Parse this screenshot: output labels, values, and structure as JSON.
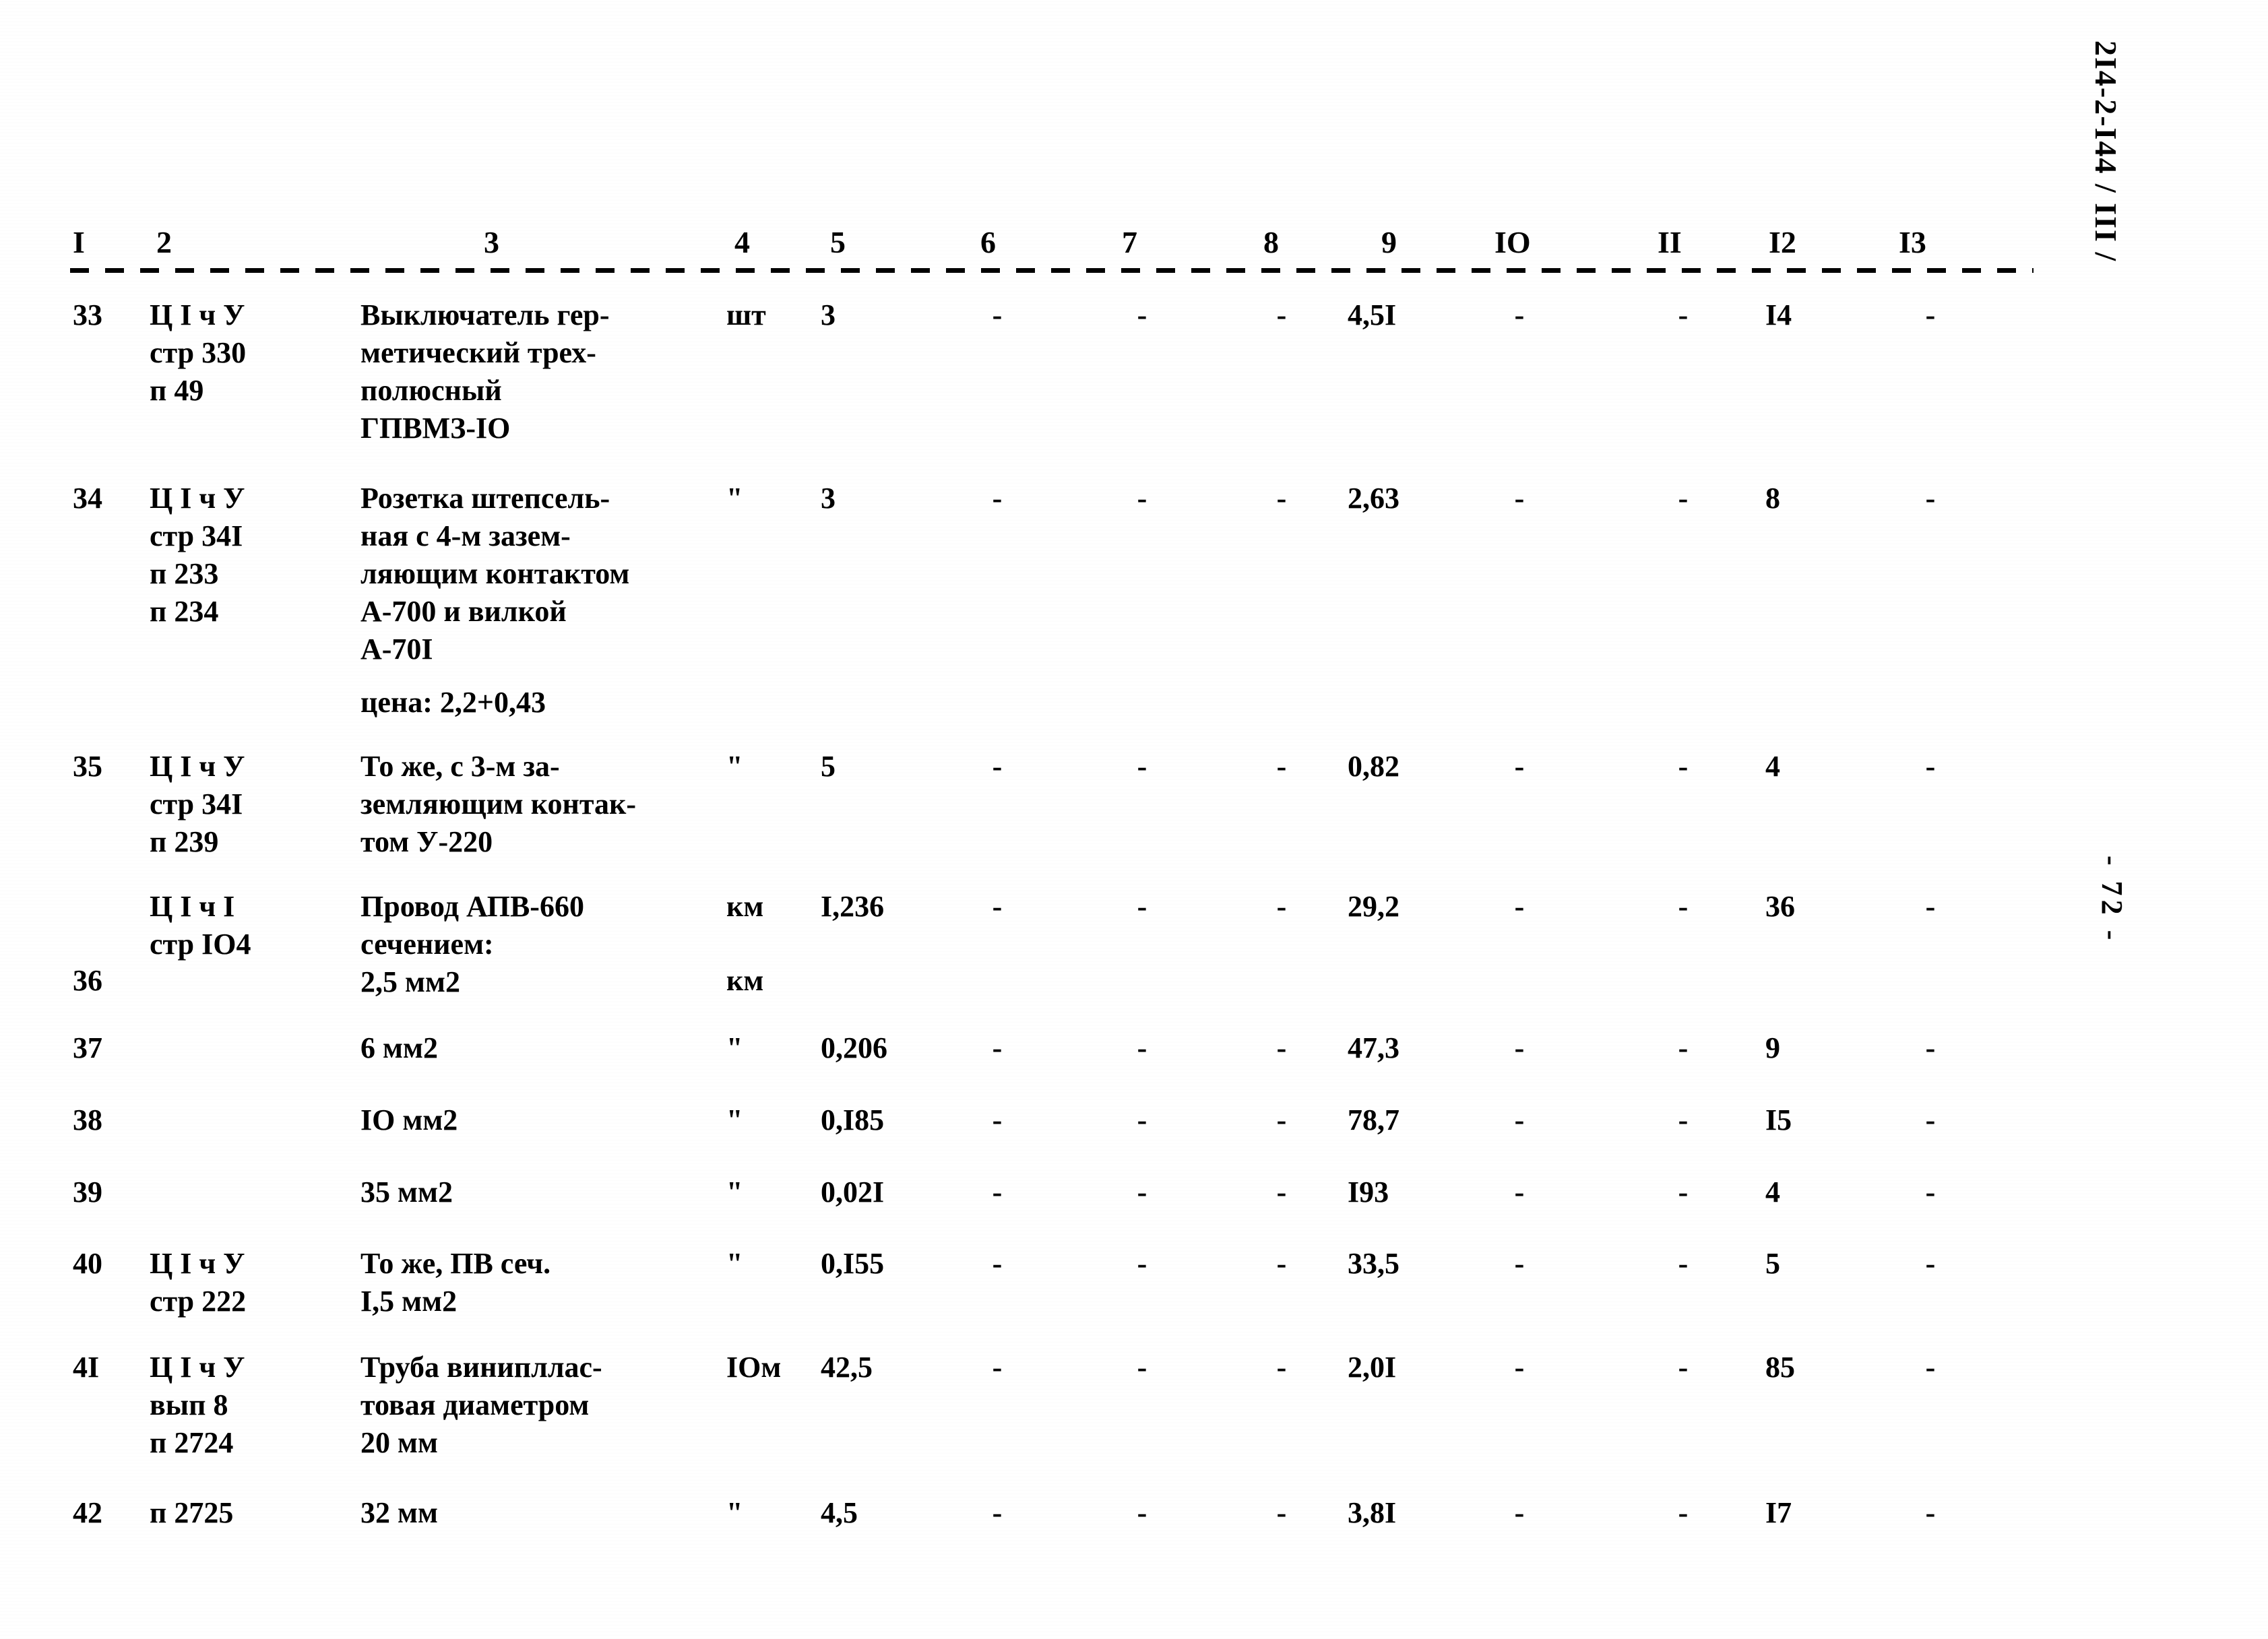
{
  "document": {
    "code": "2I4-2-I44 / III /",
    "page_marker": "- 72 -"
  },
  "table": {
    "column_numbers": [
      "I",
      "2",
      "3",
      "4",
      "5",
      "6",
      "7",
      "8",
      "9",
      "IO",
      "II",
      "I2",
      "I3"
    ],
    "dash": "-",
    "ditto": "\"",
    "rows": [
      {
        "num": "33",
        "ref": "Ц I ч У\nстр 330\nп 49",
        "desc": "Выключатель гер-\nметический трех-\nполюсный\nГПВМЗ-IO",
        "unit": "шт",
        "qty": "3",
        "c6": "-",
        "c7": "-",
        "c8": "-",
        "price": "4,5I",
        "c10": "-",
        "c11": "-",
        "c12": "I4",
        "c13": "-"
      },
      {
        "num": "34",
        "ref": "Ц I ч У\nстр 34I\nп 233\nп 234",
        "desc": "Розетка штепсель-\nная с 4-м зазем-\nляющим контактом\nА-700 и вилкой\nА-70I",
        "note": "цена: 2,2+0,43",
        "unit": "\"",
        "qty": "3",
        "c6": "-",
        "c7": "-",
        "c8": "-",
        "price": "2,63",
        "c10": "-",
        "c11": "-",
        "c12": "8",
        "c13": "-"
      },
      {
        "num": "35",
        "ref": "Ц I ч У\nстр 34I\nп 239",
        "desc": "То же, с 3-м за-\nземляющим контак-\nтом У-220",
        "unit": "\"",
        "qty": "5",
        "c6": "-",
        "c7": "-",
        "c8": "-",
        "price": "0,82",
        "c10": "-",
        "c11": "-",
        "c12": "4",
        "c13": "-"
      },
      {
        "num": "36",
        "ref": "Ц I ч I\nстр IO4",
        "desc": "Провод АПВ-660\nсечением:\n2,5 мм2",
        "unit": "км",
        "unit2": "км",
        "qty": "I,236",
        "c6": "-",
        "c7": "-",
        "c8": "-",
        "price": "29,2",
        "c10": "-",
        "c11": "-",
        "c12": "36",
        "c13": "-"
      },
      {
        "num": "37",
        "ref": "",
        "desc": "6 мм2",
        "unit": "\"",
        "qty": "0,206",
        "c6": "-",
        "c7": "-",
        "c8": "-",
        "price": "47,3",
        "c10": "-",
        "c11": "-",
        "c12": "9",
        "c13": "-"
      },
      {
        "num": "38",
        "ref": "",
        "desc": "IO мм2",
        "unit": "\"",
        "qty": "0,I85",
        "c6": "-",
        "c7": "-",
        "c8": "-",
        "price": "78,7",
        "c10": "-",
        "c11": "-",
        "c12": "I5",
        "c13": "-"
      },
      {
        "num": "39",
        "ref": "",
        "desc": "35 мм2",
        "unit": "\"",
        "qty": "0,02I",
        "c6": "-",
        "c7": "-",
        "c8": "-",
        "price": "I93",
        "c10": "-",
        "c11": "-",
        "c12": "4",
        "c13": "-"
      },
      {
        "num": "40",
        "ref": "Ц I ч У\nстр 222",
        "desc": "То же, ПВ сеч.\nI,5 мм2",
        "unit": "\"",
        "qty": "0,I55",
        "c6": "-",
        "c7": "-",
        "c8": "-",
        "price": "33,5",
        "c10": "-",
        "c11": "-",
        "c12": "5",
        "c13": "-"
      },
      {
        "num": "4I",
        "ref": "Ц I ч У\nвып 8\nп 2724",
        "desc": "Труба винипллас-\nтовая диаметром\n20 мм",
        "unit": "IOм",
        "qty": "42,5",
        "c6": "-",
        "c7": "-",
        "c8": "-",
        "price": "2,0I",
        "c10": "-",
        "c11": "-",
        "c12": "85",
        "c13": "-"
      },
      {
        "num": "42",
        "ref": "п 2725",
        "desc": "32 мм",
        "unit": "\"",
        "qty": "4,5",
        "c6": "-",
        "c7": "-",
        "c8": "-",
        "price": "3,8I",
        "c10": "-",
        "c11": "-",
        "c12": "I7",
        "c13": "-"
      }
    ]
  }
}
